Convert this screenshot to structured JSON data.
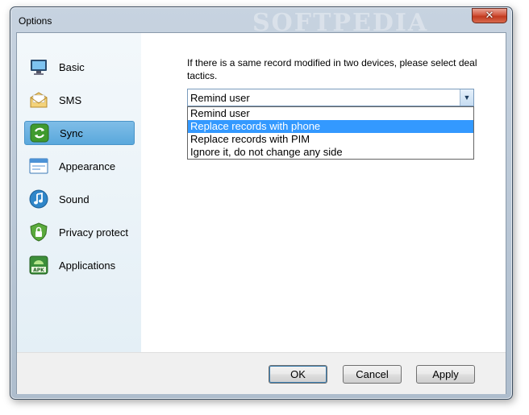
{
  "window": {
    "title": "Options",
    "watermark": "SOFTPEDIA"
  },
  "sidebar": {
    "items": [
      {
        "label": "Basic",
        "icon": "monitor-icon"
      },
      {
        "label": "SMS",
        "icon": "envelope-icon"
      },
      {
        "label": "Sync",
        "icon": "sync-icon",
        "active": true
      },
      {
        "label": "Appearance",
        "icon": "window-icon"
      },
      {
        "label": "Sound",
        "icon": "music-note-icon"
      },
      {
        "label": "Privacy protect",
        "icon": "lock-shield-icon"
      },
      {
        "label": "Applications",
        "icon": "apk-icon"
      }
    ]
  },
  "sync": {
    "description": "If there is a same record modified in two devices, please select deal tactics.",
    "combo_value": "Remind user",
    "options": [
      "Remind user",
      "Replace records with phone",
      "Replace records with PIM",
      "Ignore it, do not change any side"
    ],
    "highlighted_option": "Replace records with phone"
  },
  "footer": {
    "ok": "OK",
    "cancel": "Cancel",
    "apply": "Apply"
  },
  "colors": {
    "selection": "#3399ff",
    "active_nav": "#6bb3e2"
  }
}
